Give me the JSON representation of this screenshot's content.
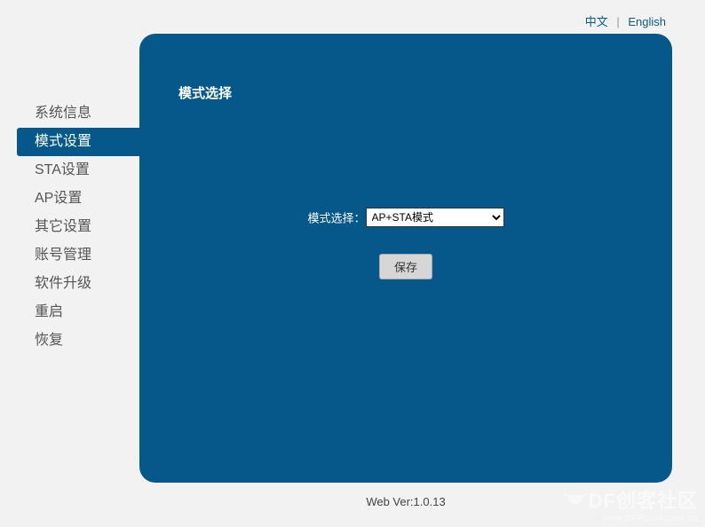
{
  "lang": {
    "zh": "中文",
    "en": "English"
  },
  "sidebar": {
    "items": [
      {
        "label": "系统信息",
        "name": "sidebar-item-sysinfo",
        "active": false
      },
      {
        "label": "模式设置",
        "name": "sidebar-item-mode",
        "active": true
      },
      {
        "label": "STA设置",
        "name": "sidebar-item-sta",
        "active": false
      },
      {
        "label": "AP设置",
        "name": "sidebar-item-ap",
        "active": false
      },
      {
        "label": "其它设置",
        "name": "sidebar-item-other",
        "active": false
      },
      {
        "label": "账号管理",
        "name": "sidebar-item-account",
        "active": false
      },
      {
        "label": "软件升级",
        "name": "sidebar-item-upgrade",
        "active": false
      },
      {
        "label": "重启",
        "name": "sidebar-item-reboot",
        "active": false
      },
      {
        "label": "恢复",
        "name": "sidebar-item-restore",
        "active": false
      }
    ]
  },
  "panel": {
    "title": "模式选择",
    "field_label": "模式选择：",
    "selected_mode": "AP+STA模式",
    "save_label": "保存"
  },
  "footer": {
    "version": "Web Ver:1.0.13"
  },
  "watermark": {
    "title": "DF创客社区",
    "url": "www.DFRobot.com.cn"
  }
}
